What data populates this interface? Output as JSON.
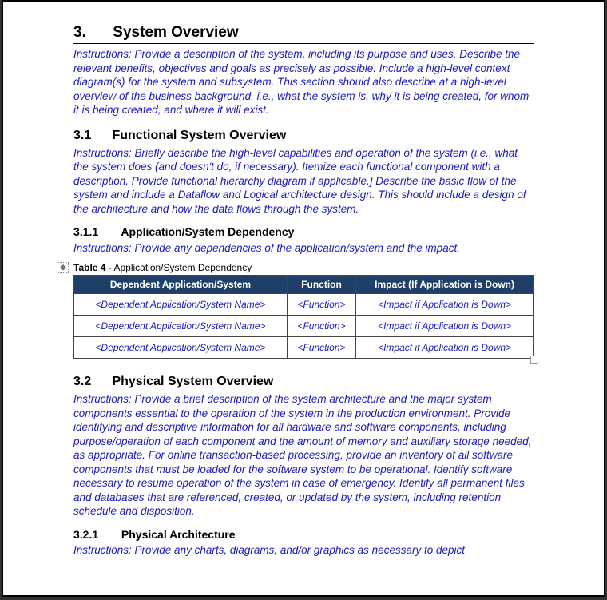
{
  "sec3": {
    "num": "3.",
    "title": "System Overview"
  },
  "sec3_instr": "Instructions: Provide a description of the system, including its purpose and uses. Describe the relevant benefits, objectives and goals as precisely as possible. Include a high-level context diagram(s) for the system and subsystem. This section should also describe at a high-level overview of the business background, i.e., what the system is, why it is being created, for whom it is being created, and where it will exist.",
  "sec31": {
    "num": "3.1",
    "title": "Functional System Overview"
  },
  "sec31_instr": "Instructions: Briefly describe the high-level capabilities and operation of the system (i.e., what the system does (and doesn't do, if necessary). Itemize each functional component with a description. Provide functional hierarchy diagram if applicable.] Describe the basic flow of the system and include a Dataflow and Logical architecture design. This should include a design of the architecture and how the data flows through the system.",
  "sec311": {
    "num": "3.1.1",
    "title": "Application/System Dependency"
  },
  "sec311_instr": "Instructions: Provide any dependencies of the application/system and the impact.",
  "table4": {
    "caption_bold": "Table 4",
    "caption_rest": " - Application/System Dependency",
    "headers": [
      "Dependent Application/System",
      "Function",
      "Impact (If Application is Down)"
    ],
    "rows": [
      [
        "<Dependent Application/System Name>",
        "<Function>",
        "<Impact if Application is Down>"
      ],
      [
        "<Dependent Application/System Name>",
        "<Function>",
        "<Impact if Application is Down>"
      ],
      [
        "<Dependent Application/System Name>",
        "<Function>",
        "<Impact if Application is Down>"
      ]
    ]
  },
  "sec32": {
    "num": "3.2",
    "title": "Physical System Overview"
  },
  "sec32_instr": "Instructions: Provide a brief description of the system architecture and the major system components essential to the operation of the system in the production environment. Provide identifying and descriptive information for all hardware and software components, including purpose/operation of each component and the amount of memory and auxiliary storage needed, as appropriate. For online transaction-based processing, provide an inventory of all software components that must be loaded for the software system to be operational. Identify software necessary to resume operation of the system in case of emergency. Identify all permanent files and databases that are referenced, created, or updated by the system, including retention schedule and disposition.",
  "sec321": {
    "num": "3.2.1",
    "title": "Physical Architecture"
  },
  "sec321_cut": "Instructions: Provide any charts, diagrams, and/or graphics as necessary to depict"
}
